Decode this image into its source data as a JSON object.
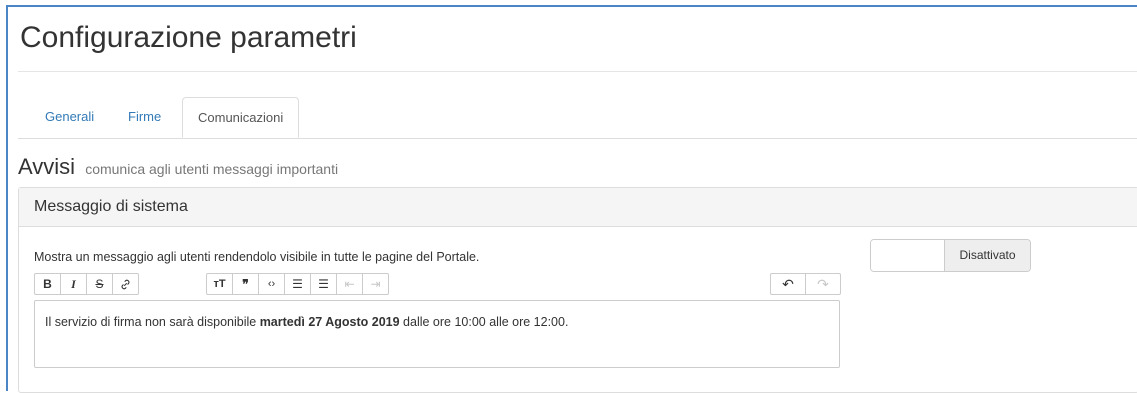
{
  "page": {
    "title": "Configurazione parametri"
  },
  "tabs": [
    {
      "label": "Generali",
      "active": false
    },
    {
      "label": "Firme",
      "active": false
    },
    {
      "label": "Comunicazioni",
      "active": true
    }
  ],
  "section": {
    "title": "Avvisi",
    "subtitle": "comunica agli utenti messaggi importanti"
  },
  "panel": {
    "heading": "Messaggio di sistema",
    "description": "Mostra un messaggio agli utenti rendendolo visibile in tutte le pagine del Portale.",
    "toggle_label": "Disattivato",
    "toggle_state": "off",
    "toolbar": {
      "format": [
        {
          "name": "bold",
          "glyph": "B"
        },
        {
          "name": "italic",
          "glyph": "I"
        },
        {
          "name": "strikethrough",
          "glyph": "S"
        },
        {
          "name": "link",
          "glyph": "🔗"
        }
      ],
      "blocks": [
        {
          "name": "heading",
          "glyph": "тT"
        },
        {
          "name": "quote",
          "glyph": "❞"
        },
        {
          "name": "code",
          "glyph": "‹›"
        },
        {
          "name": "bullet-list",
          "glyph": "☰"
        },
        {
          "name": "numbered-list",
          "glyph": "☰"
        },
        {
          "name": "outdent",
          "glyph": "⇤",
          "disabled": true
        },
        {
          "name": "indent",
          "glyph": "⇥",
          "disabled": true
        }
      ],
      "history": [
        {
          "name": "undo",
          "glyph": "↶"
        },
        {
          "name": "redo",
          "glyph": "↷",
          "disabled": true
        }
      ]
    },
    "editor": {
      "text_before": "Il servizio di firma non sarà disponibile ",
      "text_bold": "martedì 27 Agosto 2019",
      "text_after": " dalle ore 10:00 alle ore 12:00."
    }
  },
  "colors": {
    "link": "#337ab7",
    "frame": "#4a86c5"
  }
}
